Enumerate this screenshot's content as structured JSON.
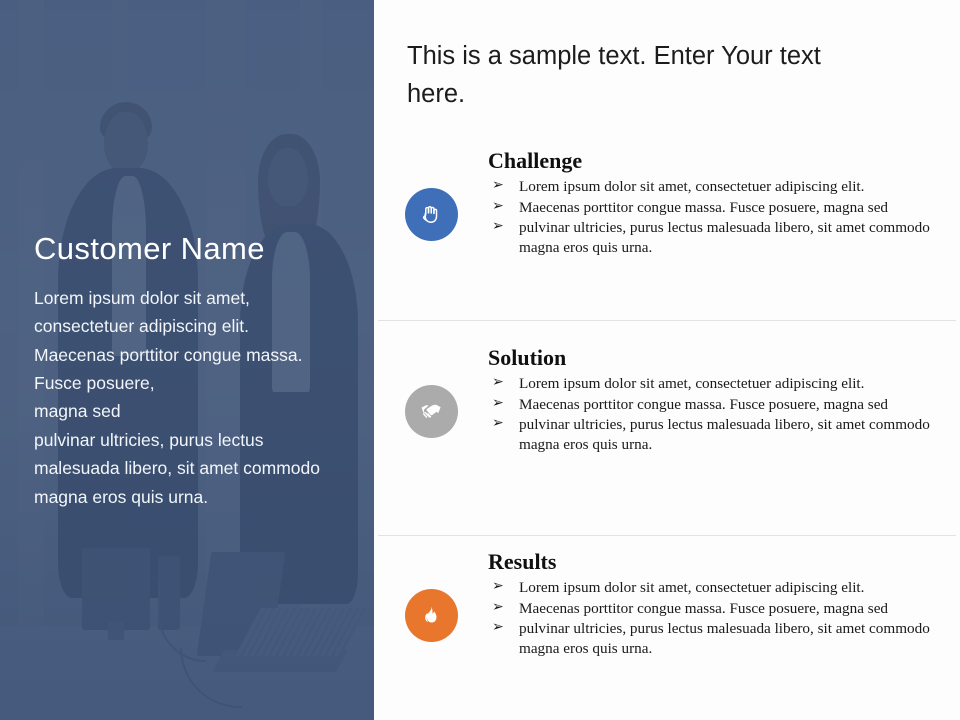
{
  "slide": {
    "title_left": "Customer Name",
    "headline": "This is a sample text. Enter Your text here."
  },
  "left_panel": {
    "name": "Customer Name",
    "description": "Lorem ipsum dolor sit amet, consectetuer adipiscing elit. Maecenas porttitor congue massa. Fusce posuere,\nmagna sed\npulvinar ultricies, purus lectus malesuada libero, sit amet commodo magna eros quis urna.",
    "background_color": "#3e5478",
    "text_color": "#ffffff",
    "photo_alt": "two business people standing in an office with desks, monitors and a laptop"
  },
  "right_panel": {
    "headline": "This is a sample text. Enter Your text here.",
    "background_color": "#fdfdfd",
    "divider_color": "#e3e3e3",
    "bullet_glyph": "➢",
    "sections": [
      {
        "id": "challenge",
        "title": "Challenge",
        "icon_name": "raised-fist-icon",
        "icon_color": "#3f6fb8",
        "bullets": [
          "Lorem ipsum dolor sit amet, consectetuer adipiscing elit.",
          "Maecenas porttitor congue massa. Fusce posuere, magna sed",
          "pulvinar ultricies,  purus lectus malesuada libero, sit amet commodo magna eros quis urna."
        ]
      },
      {
        "id": "solution",
        "title": "Solution",
        "icon_name": "handshake-icon",
        "icon_color": "#ababab",
        "bullets": [
          "Lorem ipsum dolor sit amet, consectetuer adipiscing elit.",
          "Maecenas porttitor congue massa. Fusce posuere, magna sed",
          "pulvinar ultricies,  purus lectus malesuada libero, sit amet commodo magna eros quis urna."
        ]
      },
      {
        "id": "results",
        "title": "Results",
        "icon_name": "flame-icon",
        "icon_color": "#e8762c",
        "bullets": [
          "Lorem ipsum dolor sit amet, consectetuer adipiscing elit.",
          "Maecenas porttitor congue massa. Fusce posuere, magna sed",
          "pulvinar ultricies,  purus lectus malesuada libero, sit amet commodo magna eros quis urna."
        ]
      }
    ]
  }
}
